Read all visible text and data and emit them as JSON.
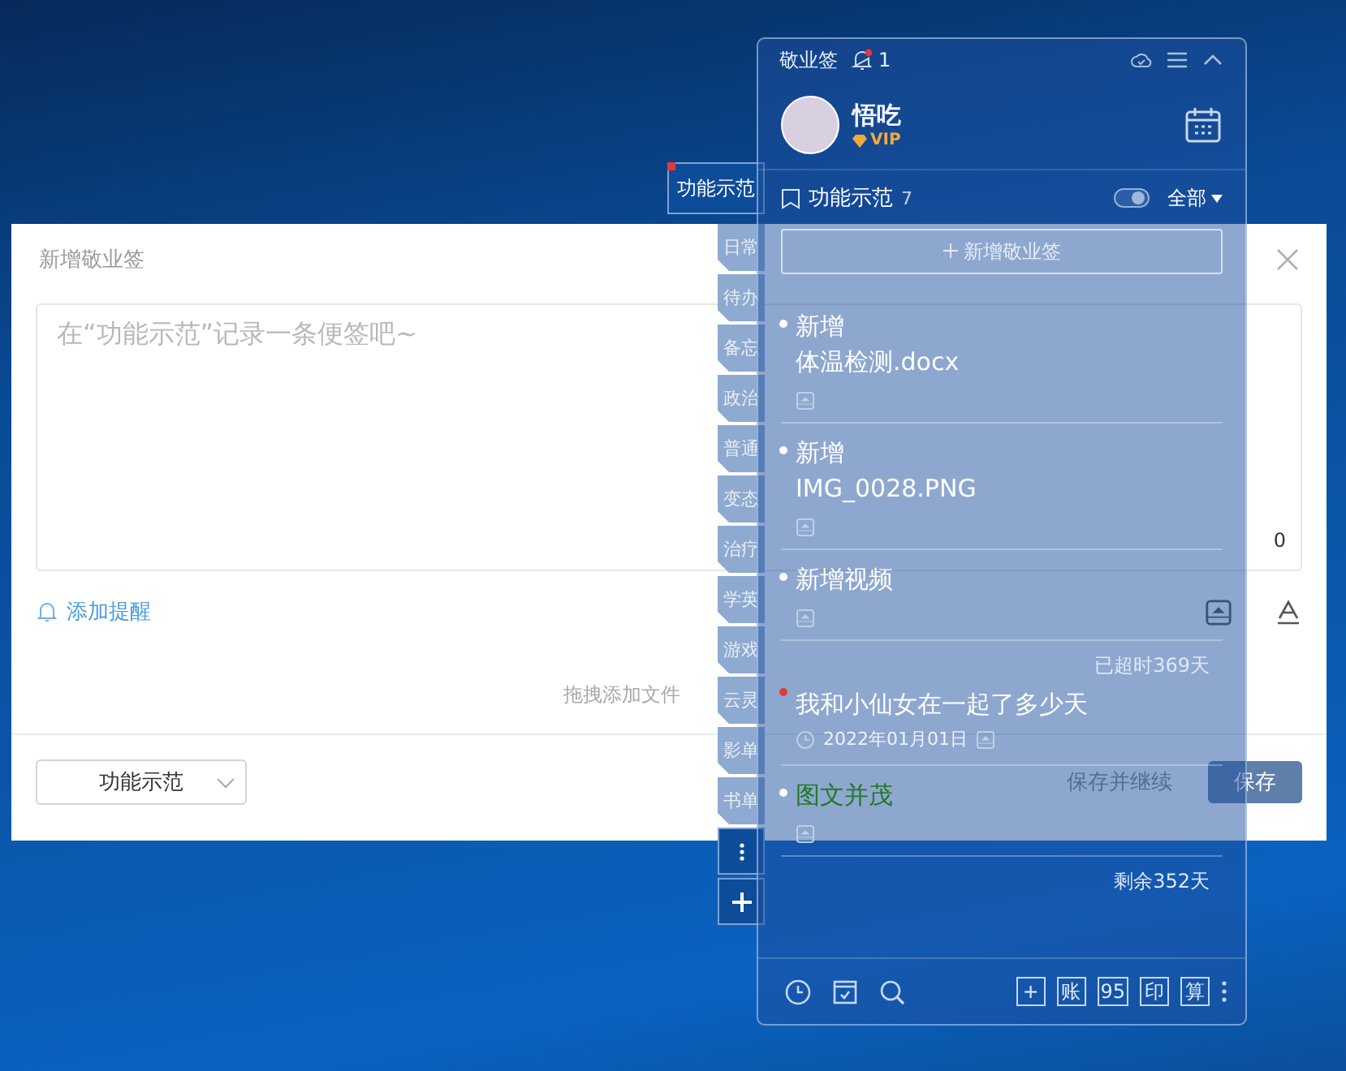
{
  "dialog": {
    "title": "新增敬业签",
    "placeholder": "在“功能示范”记录一条便签吧~",
    "char_count": "0",
    "reminder_link": "添加提醒",
    "drop_hint": "拖拽添加文件",
    "category_select": "功能示范",
    "save_continue": "保存并继续",
    "save": "保存"
  },
  "category_tabs": [
    {
      "label": "功能示范",
      "selected": true,
      "unread": true
    },
    {
      "label": "日常",
      "selected": false,
      "unread": false
    },
    {
      "label": "待办",
      "selected": false,
      "unread": false
    },
    {
      "label": "备忘",
      "selected": false,
      "unread": false
    },
    {
      "label": "政治",
      "selected": false,
      "unread": false
    },
    {
      "label": "普通",
      "selected": false,
      "unread": false
    },
    {
      "label": "变态",
      "selected": false,
      "unread": false
    },
    {
      "label": "治疗",
      "selected": false,
      "unread": false
    },
    {
      "label": "学英",
      "selected": false,
      "unread": false
    },
    {
      "label": "游戏",
      "selected": false,
      "unread": false
    },
    {
      "label": "云灵",
      "selected": false,
      "unread": false
    },
    {
      "label": "影单",
      "selected": false,
      "unread": false
    },
    {
      "label": "书单",
      "selected": false,
      "unread": false
    }
  ],
  "panel": {
    "app_name": "敬业签",
    "notification_count": "1",
    "user_name": "悟吃",
    "badge": "VIP",
    "category": "功能示范",
    "category_count": "7",
    "toggle_on": true,
    "filter": "全部",
    "add_button": "新增敬业签",
    "notes": [
      {
        "lines": [
          "新增",
          "体温检测.docx"
        ],
        "color": "#ffffff",
        "highlight": false,
        "attachment": true
      },
      {
        "lines": [
          "新增",
          "IMG_0028.PNG"
        ],
        "color": "#ffffff",
        "highlight": false,
        "attachment": true
      },
      {
        "lines": [
          "新增视频"
        ],
        "color": "#ffffff",
        "highlight": false,
        "attachment": true
      },
      {
        "status": "已超时369天",
        "lines": [
          "我和小仙女在一起了多少天"
        ],
        "color": "#e53935",
        "highlight": false,
        "date": "2022年01月01日",
        "attachment": true
      },
      {
        "lines": [
          "图文并茂"
        ],
        "color": "#ffffff",
        "highlight": true,
        "attachment": true
      },
      {
        "status": "剩余352天"
      }
    ],
    "toolbar_buttons": [
      "+",
      "账",
      "95",
      "印",
      "算"
    ]
  }
}
